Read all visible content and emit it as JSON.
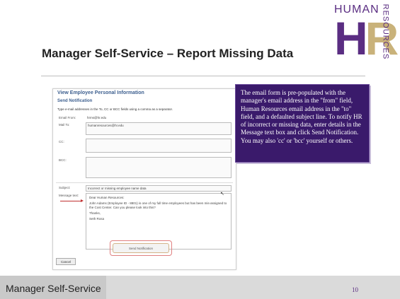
{
  "slide": {
    "title": "Manager Self-Service – Report Missing Data",
    "footer": "Manager Self-Service",
    "page_number": "10"
  },
  "logo": {
    "word_top": "HUMAN",
    "letters_h": "H",
    "letters_r": "R",
    "word_side": "RESOURCES",
    "colors": {
      "purple": "#5a2d82",
      "gold": "#c9b27a"
    }
  },
  "screenshot": {
    "header": "View Employee Personal Information",
    "section": "Send Notification",
    "instructions": "Type e-mail addresses in the To, CC or BCC fields using a comma as a separator.",
    "from_label": "Email From:",
    "from_value": "hrms@hr.edu",
    "to_label": "Mail To:",
    "to_value": "humanresources@hr.edu",
    "cc_label": "CC:",
    "bcc_label": "BCC:",
    "subject_label": "Subject:",
    "subject_value": "Incorrect or missing employee name data",
    "message_label": "Message text:",
    "message_lines": [
      "Dear Human Resources:",
      "John Adams (Employee ID - 8801) is one of my full time employees but has been mis-assigned to the Cost Center. Can you please look into this?",
      "Thanks,",
      "Seth Rosa"
    ],
    "send_button": "Send Notification",
    "cancel_button": "Cancel"
  },
  "callout": {
    "text": "The email form is pre-populated with the manager's email address in the \"from\" field, Human Resources email address in the \"to\" field, and a defaulted subject line. To notify HR of incorrect or missing data, enter details in the Message text box and click Send Notification. You may also 'cc' or 'bcc' yourself or others.",
    "colors": {
      "background": "#3a1a6b"
    }
  }
}
